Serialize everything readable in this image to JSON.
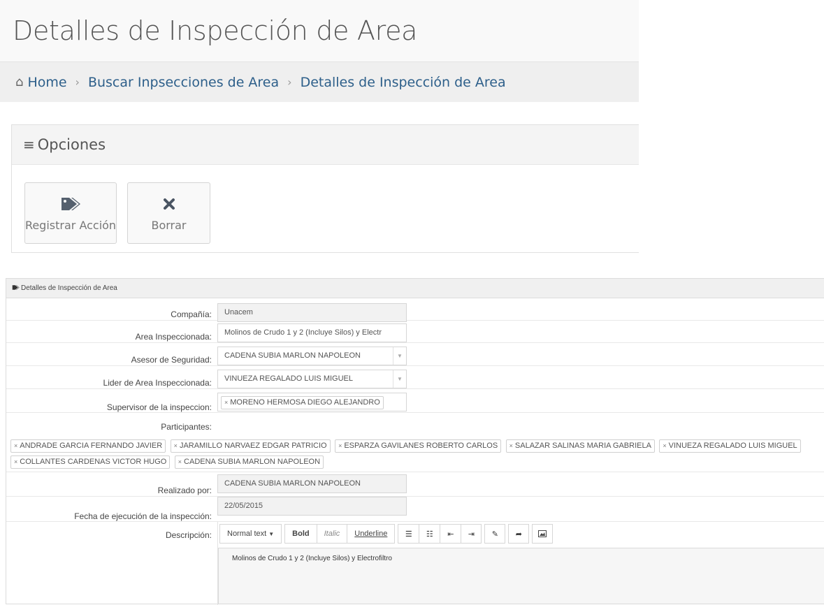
{
  "page": {
    "title": "Detalles de Inspección de Area",
    "breadcrumb": {
      "home": "Home",
      "search": "Buscar Inpsecciones de Area",
      "current": "Detalles de Inspección de Area"
    }
  },
  "opciones": {
    "title": "Opciones",
    "register_label": "Registrar Acción",
    "delete_label": "Borrar"
  },
  "details": {
    "header": "Detalles de Inspección de Area",
    "company": {
      "label": "Compañía:",
      "value": "Unacem"
    },
    "area": {
      "label": "Area Inspeccionada:",
      "value": "Molinos de Crudo 1 y 2 (Incluye Silos) y Electr"
    },
    "advisor": {
      "label": "Asesor de Seguridad:",
      "value": "CADENA SUBIA MARLON NAPOLEON"
    },
    "leader": {
      "label": "Lider de Area Inspeccionada:",
      "value": "VINUEZA REGALADO LUIS MIGUEL"
    },
    "supervisor": {
      "label": "Supervisor de la inspeccion:",
      "value": "MORENO HERMOSA DIEGO ALEJANDRO"
    },
    "participants_label": "Participantes:",
    "participants": [
      "ANDRADE GARCIA FERNANDO JAVIER",
      "JARAMILLO NARVAEZ EDGAR PATRICIO",
      "ESPARZA GAVILANES ROBERTO CARLOS",
      "SALAZAR SALINAS MARIA GABRIELA",
      "VINUEZA REGALADO LUIS MIGUEL",
      "COLLANTES CARDENAS VICTOR HUGO",
      "CADENA SUBIA MARLON NAPOLEON"
    ],
    "performed_by": {
      "label": "Realizado por:",
      "value": "CADENA SUBIA MARLON NAPOLEON"
    },
    "date": {
      "label": "Fecha de ejecución de la inspección:",
      "value": "22/05/2015"
    },
    "description": {
      "label": "Descripción:",
      "value": "Molinos de Crudo 1 y 2 (Incluye Silos) y Electrofiltro"
    }
  },
  "editor": {
    "format_label": "Normal text",
    "bold": "Bold",
    "italic": "Italic",
    "underline": "Underline"
  },
  "icons": {
    "home": "home-icon",
    "menu": "menu-icon",
    "tags": "tags-icon",
    "close": "close-icon"
  }
}
